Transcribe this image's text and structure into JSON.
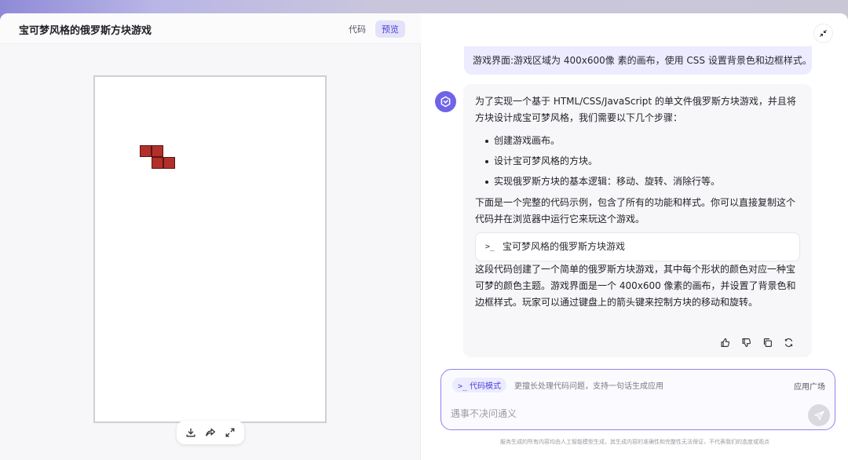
{
  "preview": {
    "title": "宝可梦风格的俄罗斯方块游戏",
    "tabs": [
      {
        "label": "代码",
        "active": false
      },
      {
        "label": "预览",
        "active": true
      }
    ],
    "block_color": "#b1302a",
    "toolbar": {
      "download_icon": "download-icon",
      "share_icon": "share-icon",
      "fullscreen_icon": "expand-icon"
    }
  },
  "chat": {
    "collapse_icon": "collapse-icon",
    "user_message": "游戏界面:游戏区域为 400x600像 素的画布，使用 CSS 设置背景色和边框样式。",
    "bot": {
      "intro": "为了实现一个基于 HTML/CSS/JavaScript 的单文件俄罗斯方块游戏，并且将方块设计成宝可梦风格，我们需要以下几个步骤：",
      "steps": [
        "创建游戏画布。",
        "设计宝可梦风格的方块。",
        "实现俄罗斯方块的基本逻辑：移动、旋转、消除行等。"
      ],
      "lead": "下面是一个完整的代码示例，包含了所有的功能和样式。你可以直接复制这个代码并在浏览器中运行它来玩这个游戏。",
      "code_ref": {
        "term": ">_",
        "label": "宝可梦风格的俄罗斯方块游戏"
      },
      "summary": "这段代码创建了一个简单的俄罗斯方块游戏，其中每个形状的颜色对应一种宝可梦的颜色主题。游戏界面是一个 400x600 像素的画布，并设置了背景色和边框样式。玩家可以通过键盘上的箭头键来控制方块的移动和旋转。"
    },
    "composer": {
      "mode_term": ">_",
      "mode_label": "代码模式",
      "mode_desc": "更擅长处理代码问题，支持一句话生成应用",
      "app_store": "应用广场",
      "placeholder": "遇事不决问通义",
      "value": ""
    },
    "disclaimer": "服务生成的所有内容均由人工智能模型生成，其生成内容的准确性和完整性无法保证，不代表我们的态度或观点"
  }
}
